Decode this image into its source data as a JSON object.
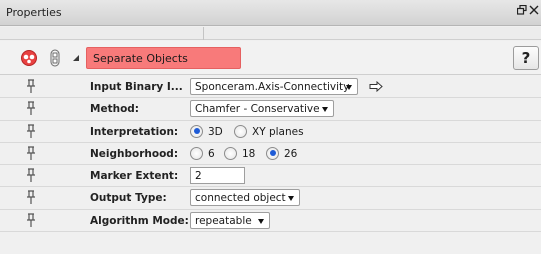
{
  "panel": {
    "title": "Properties"
  },
  "module": {
    "name": "Separate Objects",
    "help_label": "?"
  },
  "params": {
    "input": {
      "label": "Input Binary I...",
      "value": "Sponceram.Axis-Connectivity"
    },
    "method": {
      "label": "Method:",
      "value": "Chamfer - Conservative"
    },
    "interpretation": {
      "label": "Interpretation:",
      "options": [
        "3D",
        "XY planes"
      ],
      "selected": "3D"
    },
    "neighborhood": {
      "label": "Neighborhood:",
      "options": [
        "6",
        "18",
        "26"
      ],
      "selected": "26"
    },
    "marker_extent": {
      "label": "Marker Extent:",
      "value": "2"
    },
    "output_type": {
      "label": "Output Type:",
      "value": "connected object"
    },
    "algorithm_mode": {
      "label": "Algorithm Mode:",
      "value": "repeatable"
    }
  },
  "colors": {
    "module_highlight": "#f87a7a",
    "radio_accent": "#1e5bd6",
    "module_icon": "#e84141"
  },
  "icons": [
    "float-icon",
    "close-icon",
    "module-icon",
    "visibility-icon",
    "collapse-triangle-icon",
    "pin-icon",
    "connect-arrow-icon"
  ]
}
